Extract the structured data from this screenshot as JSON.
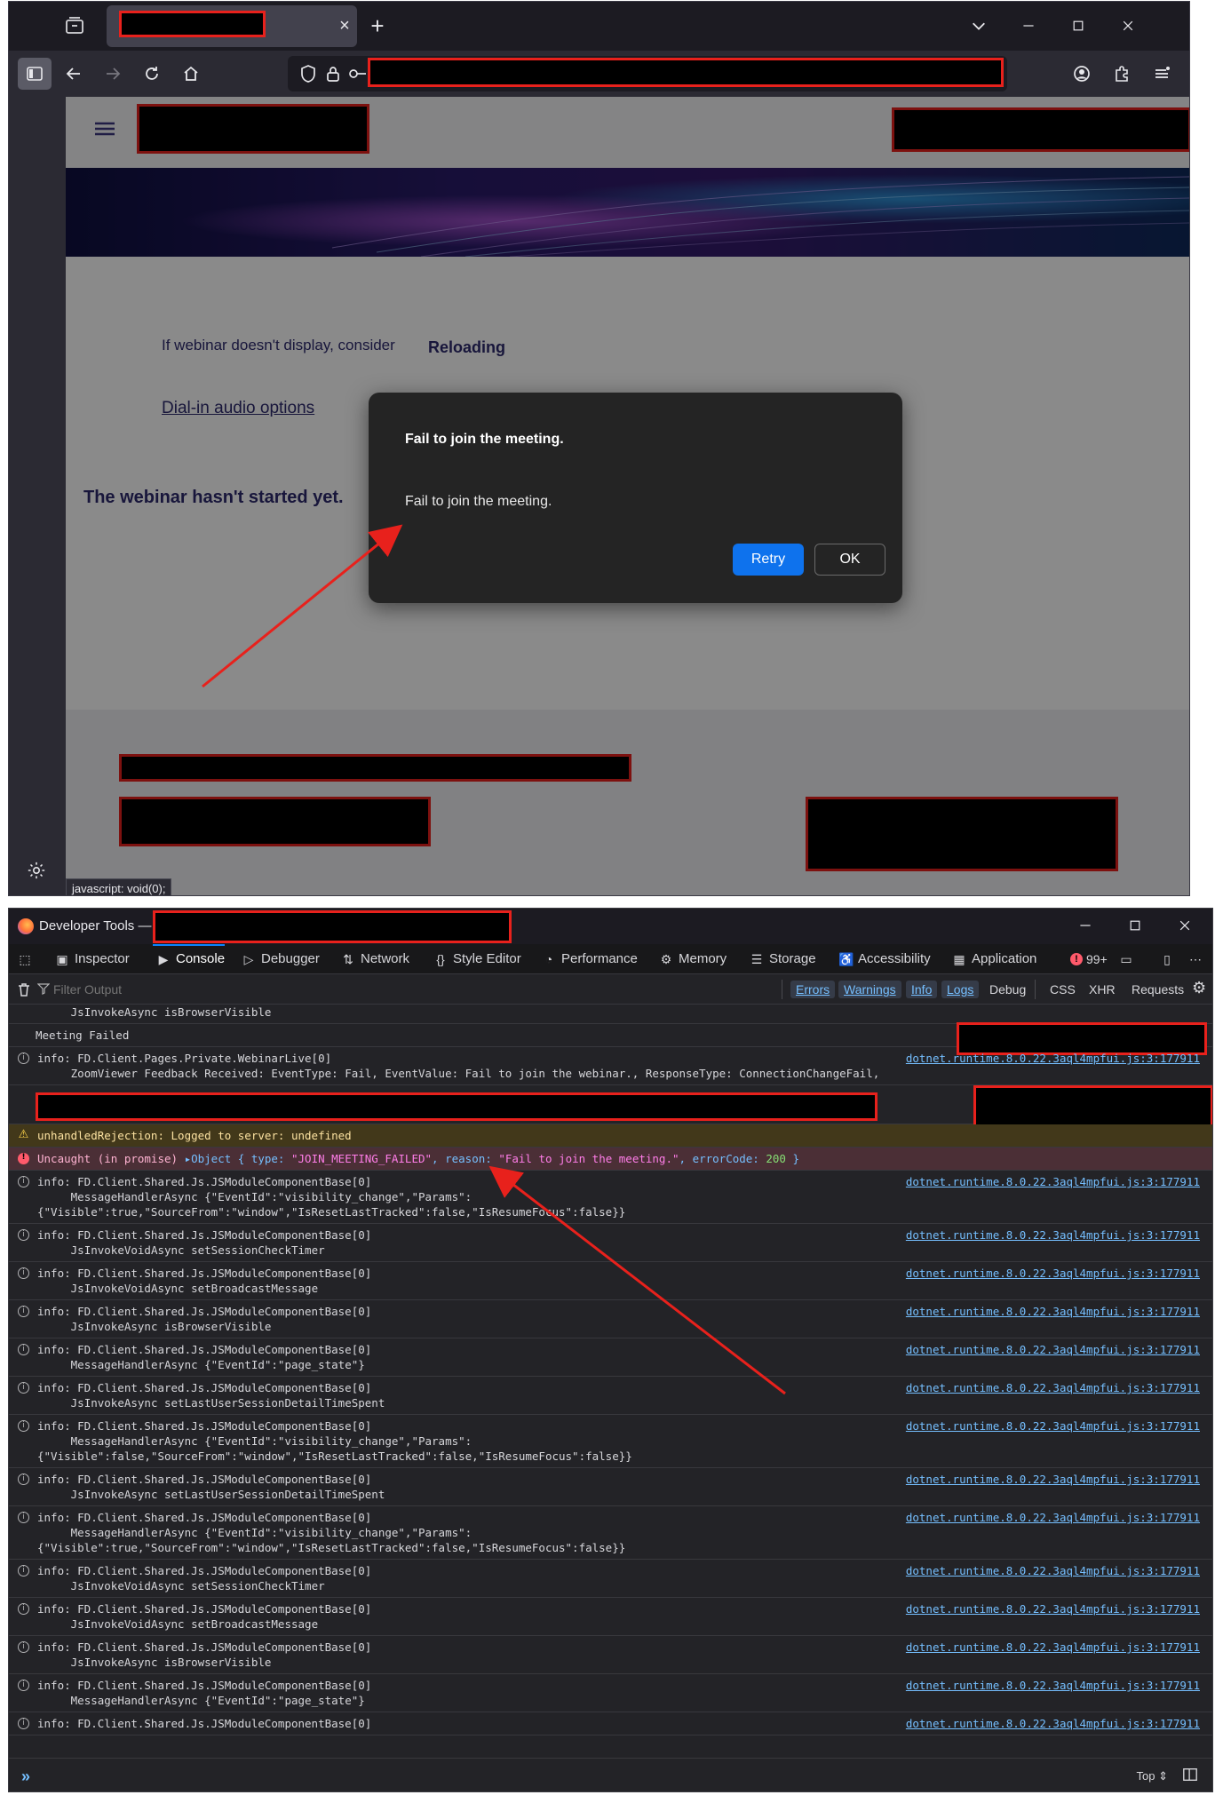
{
  "browser": {
    "tab_close_glyph": "×",
    "new_tab_glyph": "+",
    "status_url": "javascript: void(0);"
  },
  "page": {
    "hint_text": "If webinar doesn't display, consider",
    "reload_link": "Reloading",
    "dialin_link": "Dial-in audio options",
    "not_started": "The webinar hasn't started yet."
  },
  "modal": {
    "title": "Fail to join the meeting.",
    "message": "Fail to join the meeting.",
    "retry_label": "Retry",
    "ok_label": "OK"
  },
  "devtools": {
    "title": "Developer Tools —",
    "tabs": [
      "Inspector",
      "Console",
      "Debugger",
      "Network",
      "Style Editor",
      "Performance",
      "Memory",
      "Storage",
      "Accessibility",
      "Application"
    ],
    "error_count": "99+",
    "filter_placeholder": "Filter Output",
    "filters": [
      "Errors",
      "Warnings",
      "Info",
      "Logs",
      "Debug",
      "CSS",
      "XHR",
      "Requests"
    ],
    "context": "Top ⇕",
    "source": "dotnet.runtime.8.0.22.3aql4mpfui.js:3:177911",
    "logs": {
      "l0": "JsInvokeAsync isBrowserVisible",
      "l1": "Meeting Failed",
      "l2a": "info: FD.Client.Pages.Private.WebinarLive[0]",
      "l2b": "ZoomViewer Feedback Received: EventType: Fail, EventValue: Fail to join the webinar., ResponseType: ConnectionChangeFail,",
      "warn": "unhandledRejection: Logged to server: undefined",
      "err_prefix": "Uncaught (in promise)",
      "err_obj": "▸Object { type: ",
      "err_type": "\"JOIN_MEETING_FAILED\"",
      "err_mid": ", reason: ",
      "err_reason": "\"Fail to join the meeting.\"",
      "err_code_label": ", errorCode: ",
      "err_code": "200",
      "err_end": " }",
      "component": "info: FD.Client.Shared.Js.JSModuleComponentBase[0]",
      "vis_true_a": "MessageHandlerAsync {\"EventId\":\"visibility_change\",\"Params\":",
      "vis_true_b": "{\"Visible\":true,\"SourceFrom\":\"window\",\"IsResetLastTracked\":false,\"IsResumeFocus\":false}}",
      "vis_false_b": "{\"Visible\":false,\"SourceFrom\":\"window\",\"IsResetLastTracked\":false,\"IsResumeFocus\":false}}",
      "session_timer": "JsInvokeVoidAsync setSessionCheckTimer",
      "broadcast": "JsInvokeVoidAsync setBroadcastMessage",
      "browser_visible": "JsInvokeAsync isBrowserVisible",
      "page_state": "MessageHandlerAsync {\"EventId\":\"page_state\"}",
      "time_spent": "JsInvokeAsync setLastUserSessionDetailTimeSpent"
    }
  },
  "colors": {
    "accent_blue": "#0e72ed",
    "annotation_red": "#e8211c",
    "link_blue": "#75bfff"
  }
}
